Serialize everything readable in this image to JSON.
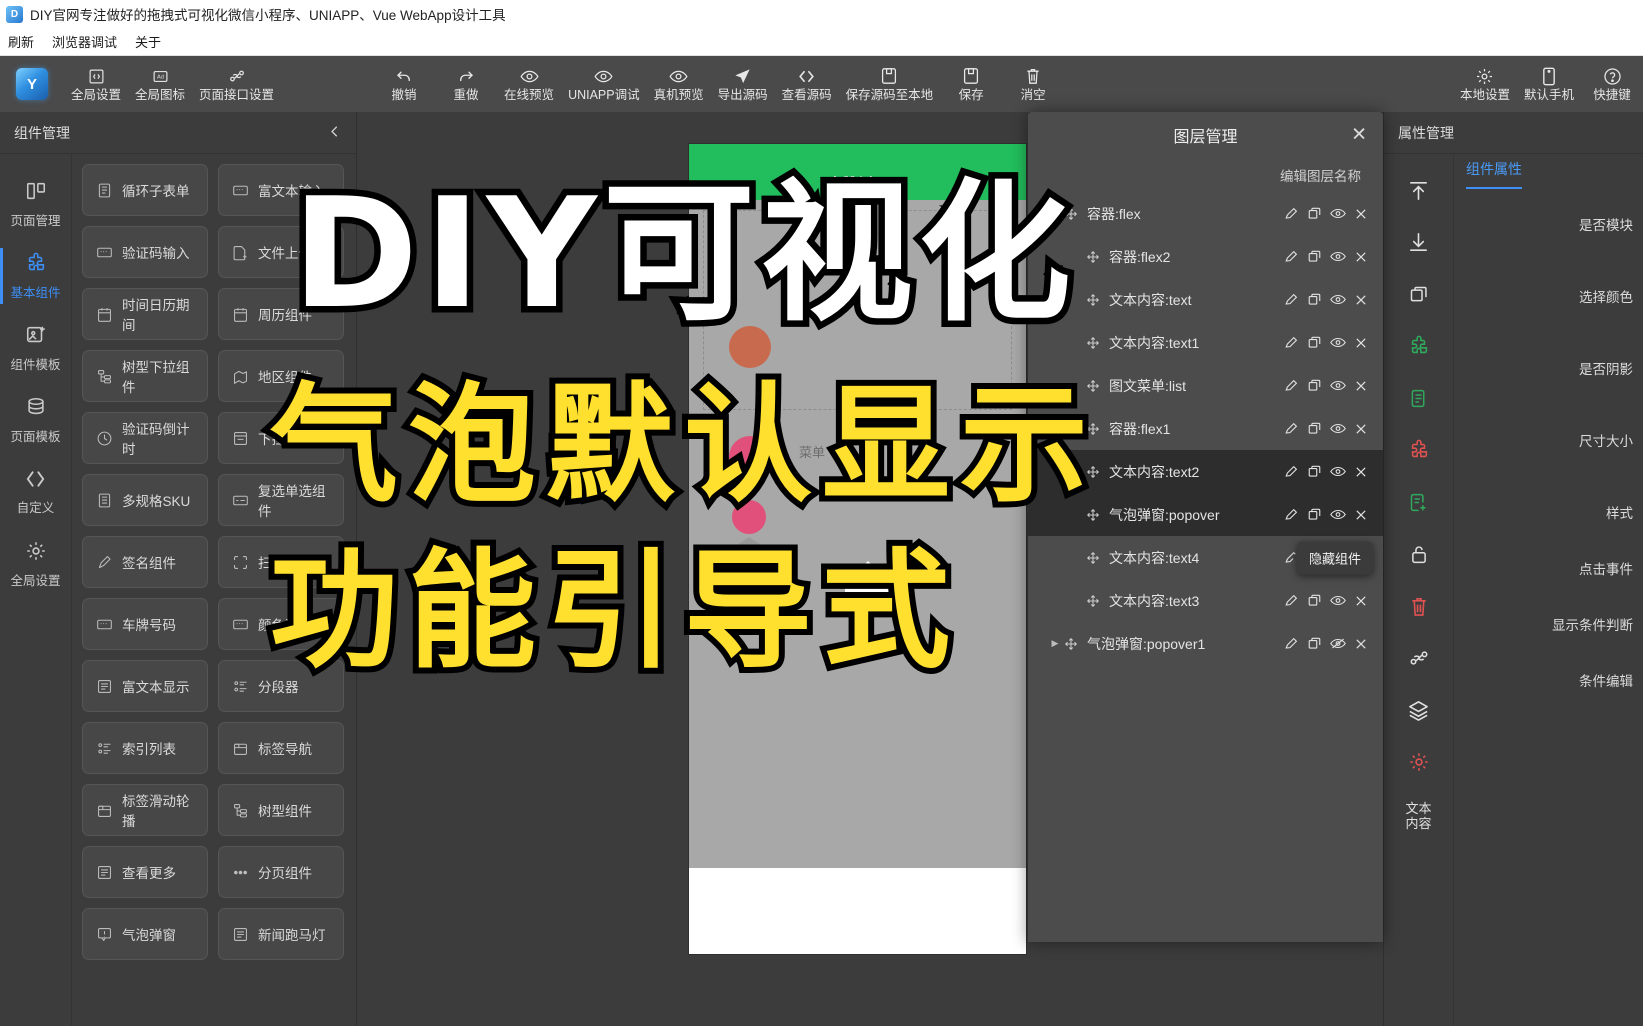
{
  "titlebar": {
    "title": "DIY官网专注做好的拖拽式可视化微信小程序、UNIAPP、Vue WebApp设计工具",
    "logo_text": "D"
  },
  "menubar": {
    "items": [
      "刷新",
      "浏览器调试",
      "关于"
    ]
  },
  "toolbar": {
    "logo_text": "Y",
    "left_items": [
      {
        "label": "全局设置",
        "icon": "code-frame-icon"
      },
      {
        "label": "全局图标",
        "icon": "ad-icon"
      },
      {
        "label": "页面接口设置",
        "icon": "link-icon"
      }
    ],
    "mid_items": [
      {
        "label": "撤销",
        "icon": "undo-icon"
      },
      {
        "label": "重做",
        "icon": "redo-icon"
      },
      {
        "label": "在线预览",
        "icon": "eye-icon"
      },
      {
        "label": "UNIAPP调试",
        "icon": "eye-icon"
      },
      {
        "label": "真机预览",
        "icon": "eye-icon"
      },
      {
        "label": "导出源码",
        "icon": "send-icon"
      },
      {
        "label": "查看源码",
        "icon": "code-icon"
      },
      {
        "label": "保存源码至本地",
        "icon": "save-icon"
      },
      {
        "label": "保存",
        "icon": "save-icon"
      },
      {
        "label": "消空",
        "icon": "trash-icon"
      }
    ],
    "right_items": [
      {
        "label": "本地设置",
        "icon": "gear-icon"
      },
      {
        "label": "默认手机",
        "icon": "phone-icon"
      },
      {
        "label": "快捷键",
        "icon": "help-icon"
      }
    ]
  },
  "left_panel": {
    "title": "组件管理",
    "collapse_icon": "chevron-left-icon",
    "rail": [
      {
        "label": "页面管理",
        "icon": "pages-icon",
        "active": false
      },
      {
        "label": "基本组件",
        "icon": "puzzle-icon",
        "active": true
      },
      {
        "label": "组件模板",
        "icon": "template-icon",
        "active": false
      },
      {
        "label": "页面模板",
        "icon": "database-icon",
        "active": false
      },
      {
        "label": "自定义",
        "icon": "code-icon",
        "active": false
      },
      {
        "label": "全局设置",
        "icon": "gear-icon",
        "active": false
      }
    ],
    "components": [
      {
        "label": "循环子表单",
        "icon": "form-icon"
      },
      {
        "label": "富文本输入",
        "icon": "input-icon"
      },
      {
        "label": "验证码输入",
        "icon": "input-icon"
      },
      {
        "label": "文件上传",
        "icon": "upload-icon"
      },
      {
        "label": "时间日历期间",
        "icon": "calendar-icon"
      },
      {
        "label": "周历组件",
        "icon": "calendar-icon"
      },
      {
        "label": "树型下拉组件",
        "icon": "tree-icon"
      },
      {
        "label": "地区组件",
        "icon": "map-icon"
      },
      {
        "label": "验证码倒计时",
        "icon": "clock-icon"
      },
      {
        "label": "下拉选择",
        "icon": "select-icon"
      },
      {
        "label": "多规格SKU",
        "icon": "sku-icon"
      },
      {
        "label": "复选单选组件",
        "icon": "checkbox-icon"
      },
      {
        "label": "签名组件",
        "icon": "pen-icon"
      },
      {
        "label": "扫码输入",
        "icon": "scan-icon"
      },
      {
        "label": "车牌号码",
        "icon": "input-icon"
      },
      {
        "label": "颜色选择",
        "icon": "input-icon"
      },
      {
        "label": "富文本显示",
        "icon": "richtext-icon"
      },
      {
        "label": "分段器",
        "icon": "list-icon"
      },
      {
        "label": "索引列表",
        "icon": "list-icon"
      },
      {
        "label": "标签导航",
        "icon": "tab-icon"
      },
      {
        "label": "标签滑动轮播",
        "icon": "tab-icon"
      },
      {
        "label": "树型组件",
        "icon": "tree-icon"
      },
      {
        "label": "查看更多",
        "icon": "richtext-icon"
      },
      {
        "label": "分页组件",
        "icon": "dots-icon"
      },
      {
        "label": "气泡弹窗",
        "icon": "popover-icon"
      },
      {
        "label": "新闻跑马灯",
        "icon": "richtext-icon"
      }
    ]
  },
  "canvas": {
    "phone": {
      "nav_title": "点赞例子",
      "menu_label": "菜单",
      "popover_text": "气泡功能"
    }
  },
  "layer_panel": {
    "title": "图层管理",
    "close_icon": "close-icon",
    "column_header": "编辑图层名称",
    "rows": [
      {
        "name": "容器:flex",
        "depth": 0,
        "caret": "▼",
        "selected": false,
        "hidden": false
      },
      {
        "name": "容器:flex2",
        "depth": 1,
        "caret": "",
        "selected": false,
        "hidden": false
      },
      {
        "name": "文本内容:text",
        "depth": 1,
        "caret": "",
        "selected": false,
        "hidden": false
      },
      {
        "name": "文本内容:text1",
        "depth": 1,
        "caret": "",
        "selected": false,
        "hidden": false
      },
      {
        "name": "图文菜单:list",
        "depth": 1,
        "caret": "",
        "selected": false,
        "hidden": false
      },
      {
        "name": "容器:flex1",
        "depth": 1,
        "caret": "",
        "selected": false,
        "hidden": false
      },
      {
        "name": "文本内容:text2",
        "depth": 1,
        "caret": "",
        "selected": true,
        "hidden": false
      },
      {
        "name": "气泡弹窗:popover",
        "depth": 1,
        "caret": "",
        "selected": true,
        "hidden": false
      },
      {
        "name": "文本内容:text4",
        "depth": 1,
        "caret": "",
        "selected": false,
        "hidden": false
      },
      {
        "name": "文本内容:text3",
        "depth": 1,
        "caret": "",
        "selected": false,
        "hidden": false
      },
      {
        "name": "气泡弹窗:popover1",
        "depth": 0,
        "caret": "▶",
        "selected": false,
        "hidden": true
      }
    ],
    "row_actions": [
      "edit-icon",
      "copy-icon",
      "eye-icon",
      "close-icon"
    ],
    "tooltip": "隐藏组件"
  },
  "right_panel": {
    "title": "属性管理",
    "rail": [
      {
        "icon": "move-up-icon",
        "color": "#e0e0e0"
      },
      {
        "icon": "move-down-icon",
        "color": "#e0e0e0"
      },
      {
        "icon": "copy-icon",
        "color": "#e0e0e0"
      },
      {
        "icon": "puzzle-add-green-icon",
        "color": "#2faa5d"
      },
      {
        "icon": "doc-green-icon",
        "color": "#2faa5d"
      },
      {
        "icon": "puzzle-red-icon",
        "color": "#e05252"
      },
      {
        "icon": "doc-add-green-icon",
        "color": "#2faa5d"
      },
      {
        "icon": "unlock-icon",
        "color": "#e0e0e0"
      },
      {
        "icon": "trash-red-icon",
        "color": "#e05252"
      },
      {
        "icon": "link-icon",
        "color": "#e0e0e0"
      },
      {
        "icon": "layers-icon",
        "color": "#e0e0e0"
      },
      {
        "icon": "gear-red-icon",
        "color": "#e05252"
      },
      {
        "icon": "text-content-label",
        "label": "文本\n内容",
        "color": "#e0e0e0"
      }
    ],
    "tab": "组件属性",
    "properties": [
      "是否模块",
      "选择颜色",
      "是否阴影",
      "尺寸大小",
      "样式",
      "点击事件",
      "显示条件判断",
      "条件编辑"
    ]
  },
  "overlay": {
    "line1": "DIY可视化",
    "line2": "气泡默认显示",
    "line3": "功能引导式"
  }
}
